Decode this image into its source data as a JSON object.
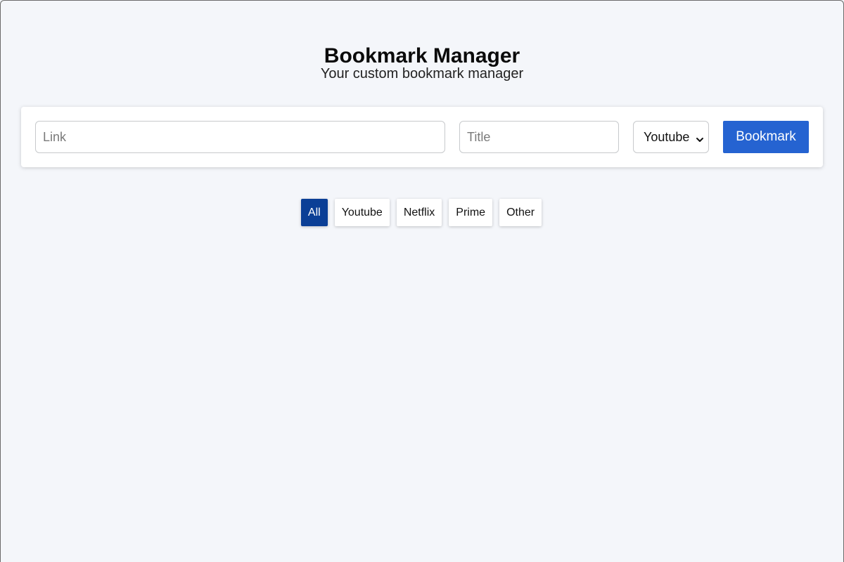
{
  "header": {
    "title": "Bookmark Manager",
    "subtitle": "Your custom bookmark manager"
  },
  "form": {
    "link_placeholder": "Link",
    "link_value": "",
    "title_placeholder": "Title",
    "title_value": "",
    "category_selected": "Youtube",
    "submit_label": "Bookmark"
  },
  "filters": {
    "items": [
      {
        "label": "All",
        "active": true
      },
      {
        "label": "Youtube",
        "active": false
      },
      {
        "label": "Netflix",
        "active": false
      },
      {
        "label": "Prime",
        "active": false
      },
      {
        "label": "Other",
        "active": false
      }
    ]
  },
  "colors": {
    "background": "#f4f6fa",
    "primary_button": "#2563d1",
    "active_filter": "#0b3f96"
  },
  "icons": {
    "select_arrow": "chevron-down-icon"
  }
}
